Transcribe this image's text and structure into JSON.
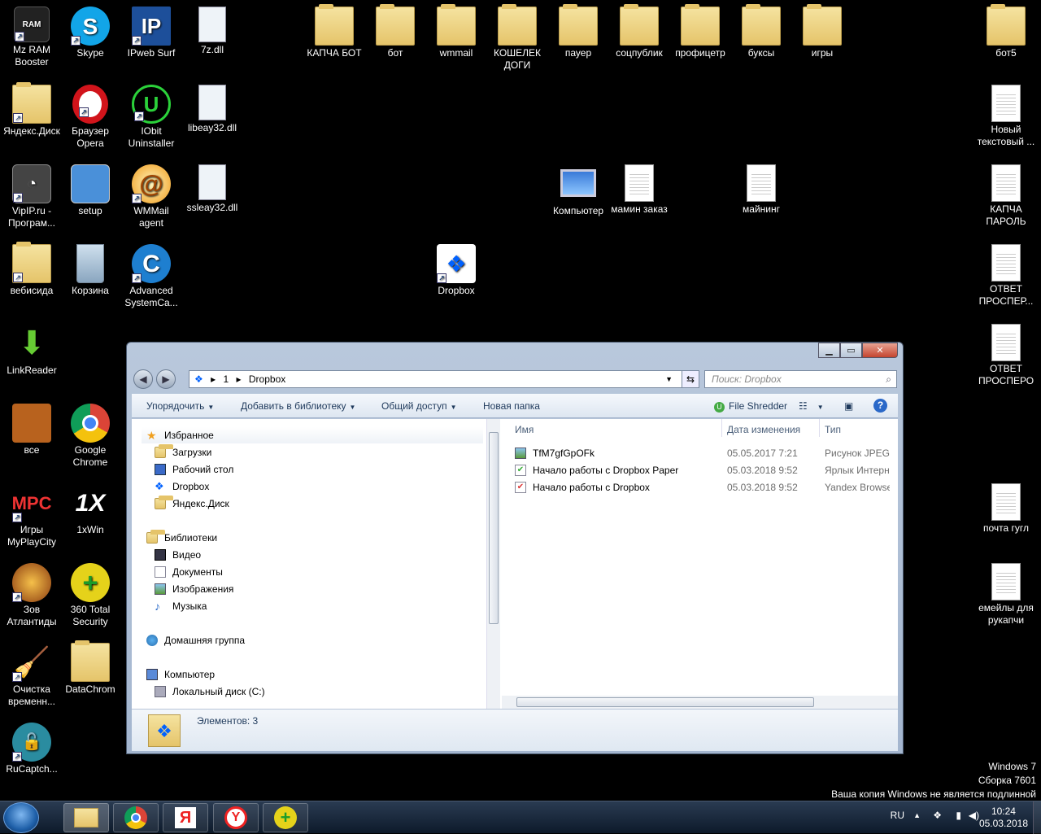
{
  "desktop": {
    "icons": [
      {
        "label": "Mz RAM Booster"
      },
      {
        "label": "Skype"
      },
      {
        "label": "IPweb Surf"
      },
      {
        "label": "7z.dll"
      },
      {
        "label": "КАПЧА БОТ"
      },
      {
        "label": "бот"
      },
      {
        "label": "wmmail"
      },
      {
        "label": "КОШЕЛЕК ДОГИ"
      },
      {
        "label": "пауер"
      },
      {
        "label": "соцпублик"
      },
      {
        "label": "профицетр"
      },
      {
        "label": "буксы"
      },
      {
        "label": "игры"
      },
      {
        "label": "бот5"
      },
      {
        "label": "Яндекс.Диск"
      },
      {
        "label": "Браузер Opera"
      },
      {
        "label": "IObit Uninstaller"
      },
      {
        "label": "libeay32.dll"
      },
      {
        "label": "Новый текстовый ..."
      },
      {
        "label": "VipIP.ru - Програм..."
      },
      {
        "label": "setup"
      },
      {
        "label": "WMMail agent"
      },
      {
        "label": "ssleay32.dll"
      },
      {
        "label": "Компьютер"
      },
      {
        "label": "мамин заказ"
      },
      {
        "label": "майнинг"
      },
      {
        "label": "КАПЧА ПАРОЛЬ"
      },
      {
        "label": "вебисида"
      },
      {
        "label": "Корзина"
      },
      {
        "label": "Advanced SystemCa..."
      },
      {
        "label": "Dropbox"
      },
      {
        "label": "ОТВЕТ ПРОСПЕР..."
      },
      {
        "label": "LinkReader"
      },
      {
        "label": "ОТВЕТ ПРОСПЕРО"
      },
      {
        "label": "все"
      },
      {
        "label": "Google Chrome"
      },
      {
        "label": "Игры MyPlayCity"
      },
      {
        "label": "1xWin"
      },
      {
        "label": "почта гугл"
      },
      {
        "label": "Зов Атлантиды"
      },
      {
        "label": "360 Total Security"
      },
      {
        "label": "емейлы для рукапчи"
      },
      {
        "label": "Очистка временн..."
      },
      {
        "label": "DataChrom"
      },
      {
        "label": "RuCaptch..."
      }
    ],
    "watermark": {
      "line1": "Windows 7",
      "line2": "Сборка 7601",
      "line3": "Ваша копия Windows не является подлинной"
    }
  },
  "window": {
    "address": {
      "seg1": "1",
      "seg2": "Dropbox"
    },
    "search_placeholder": "Поиск: Dropbox",
    "toolbar": {
      "organize": "Упорядочить",
      "add_library": "Добавить в библиотеку",
      "share": "Общий доступ",
      "new_folder": "Новая папка",
      "file_shredder": "File Shredder"
    },
    "nav": {
      "favorites": "Избранное",
      "downloads": "Загрузки",
      "desktop": "Рабочий стол",
      "dropbox": "Dropbox",
      "yandex_disk": "Яндекс.Диск",
      "libraries": "Библиотеки",
      "video": "Видео",
      "documents": "Документы",
      "images": "Изображения",
      "music": "Музыка",
      "homegroup": "Домашняя группа",
      "computer": "Компьютер",
      "local_disk": "Локальный диск (C:)"
    },
    "columns": {
      "name": "Имя",
      "date": "Дата изменения",
      "type": "Тип"
    },
    "files": [
      {
        "name": "TfM7gfGpOFk",
        "date": "05.05.2017 7:21",
        "type": "Рисунок JPEG"
      },
      {
        "name": "Начало работы с Dropbox Paper",
        "date": "05.03.2018 9:52",
        "type": "Ярлык Интернет"
      },
      {
        "name": "Начало работы с Dropbox",
        "date": "05.03.2018 9:52",
        "type": "Yandex Browser F"
      }
    ],
    "status": "Элементов: 3"
  },
  "taskbar": {
    "lang": "RU",
    "time": "10:24",
    "date": "05.03.2018"
  }
}
